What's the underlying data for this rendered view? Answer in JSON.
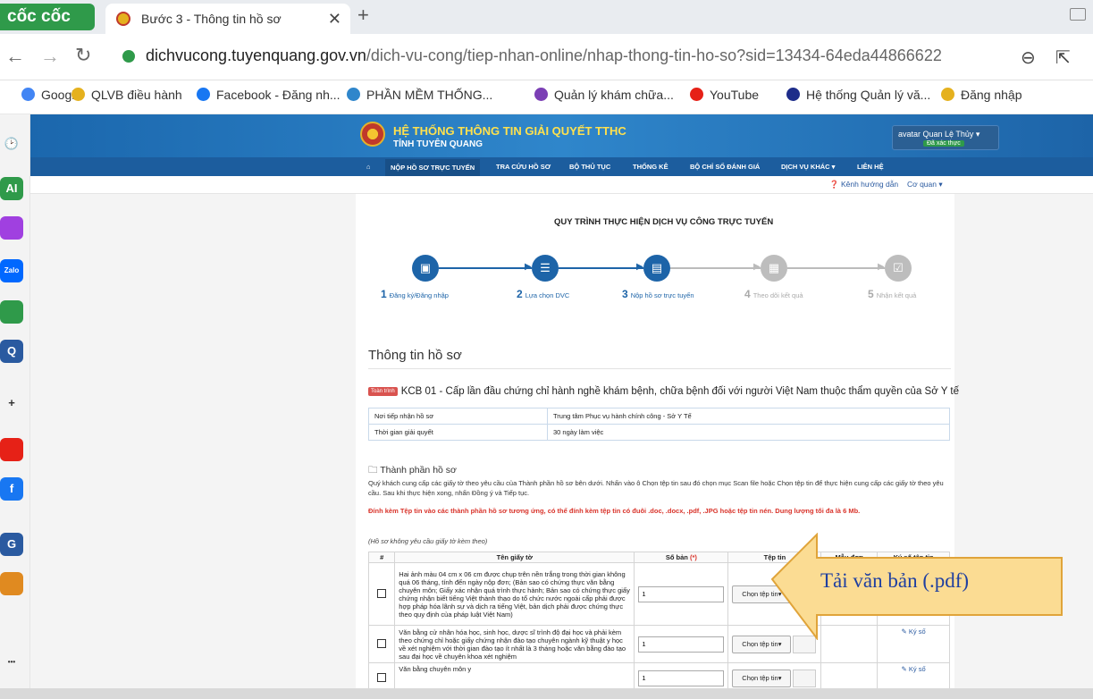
{
  "browser": {
    "brand": "cốc cốc",
    "tab_title": "Bước 3 - Thông tin hồ sơ",
    "tab_close": "✕",
    "new_tab": "+",
    "url_domain": "dichvucong.tuyenquang.gov.vn",
    "url_path": "/dich-vu-cong/tiep-nhan-online/nhap-thong-tin-ho-so?sid=13434-64eda44866622",
    "bookmarks": [
      {
        "label": "Google",
        "color": "#4285f4"
      },
      {
        "label": "QLVB điều hành",
        "color": "#e5b11e"
      },
      {
        "label": "Facebook - Đăng nh...",
        "color": "#1877f2"
      },
      {
        "label": "PHẦN MỀM THỐNG...",
        "color": "#2f86cb"
      },
      {
        "label": "Quản lý khám chữa...",
        "color": "#7b3fb5"
      },
      {
        "label": "YouTube",
        "color": "#e62117"
      },
      {
        "label": "Hệ thống Quản lý vă...",
        "color": "#1e2d8a"
      },
      {
        "label": "Đăng nhập",
        "color": "#e5b11e"
      }
    ]
  },
  "dock": [
    {
      "icon": "clock-icon",
      "label": "🕑",
      "color": "#333333"
    },
    {
      "icon": "ai-icon",
      "label": "AI",
      "color": "#2f9a4a"
    },
    {
      "icon": "messenger-icon",
      "label": "",
      "color": "#a040e0"
    },
    {
      "icon": "zalo-icon",
      "label": "Zalo",
      "color": "#0068ff"
    },
    {
      "icon": "chat-icon",
      "label": "",
      "color": "#2f9a4a"
    },
    {
      "icon": "search-app-icon",
      "label": "Q",
      "color": "#2a5aa0"
    },
    {
      "icon": "plus-icon",
      "label": "+",
      "color": "#333333"
    },
    {
      "icon": "youtube-icon",
      "label": "",
      "color": "#e62117"
    },
    {
      "icon": "facebook-icon",
      "label": "f",
      "color": "#1877f2"
    },
    {
      "icon": "gemini-icon",
      "label": "G",
      "color": "#2a5aa0"
    },
    {
      "icon": "colorful-icon",
      "label": "",
      "color": "#e08a20"
    },
    {
      "icon": "more-icon",
      "label": "•••",
      "color": "#333333"
    }
  ],
  "portal": {
    "title": "HỆ THỐNG THÔNG TIN GIẢI QUYẾT TTHC",
    "subtitle": "TỈNH TUYÊN QUANG",
    "user_label": "avatar Quan Lệ Thủy ▾",
    "user_verified": "Đã xác thực",
    "nav": [
      "NỘP HỒ SƠ TRỰC TUYẾN",
      "TRA CỨU HỒ SƠ",
      "BỘ THỦ TỤC",
      "THỐNG KÊ",
      "BỘ CHỈ SỐ ĐÁNH GIÁ",
      "DỊCH VỤ KHÁC ▾",
      "LIÊN HỆ"
    ],
    "guide_link": "❓ Kênh hướng dẫn",
    "agency_link": "Cơ quan ▾"
  },
  "process": {
    "title": "QUY TRÌNH THỰC HIỆN DỊCH VỤ CÔNG TRỰC TUYẾN",
    "steps": [
      {
        "num": "1",
        "label": "Đăng ký/Đăng nhập",
        "active": true
      },
      {
        "num": "2",
        "label": "Lựa chọn DVC",
        "active": true
      },
      {
        "num": "3",
        "label": "Nộp hồ sơ trực tuyến",
        "active": true
      },
      {
        "num": "4",
        "label": "Theo dõi kết quả",
        "active": false
      },
      {
        "num": "5",
        "label": "Nhận kết quả",
        "active": false
      }
    ]
  },
  "form": {
    "section_title": "Thông tin hồ sơ",
    "badge": "Toàn trình",
    "procedure_name": "KCB 01 - Cấp lần đầu chứng chỉ hành nghề khám bệnh, chữa bệnh đối với người Việt Nam thuộc thẩm quyền của Sở Y tế",
    "info": [
      {
        "label": "Nơi tiếp nhận hồ sơ",
        "value": "Trung tâm Phục vụ hành chính công - Sở Y Tế"
      },
      {
        "label": "Thời gian giải quyết",
        "value": "30 ngày làm việc"
      }
    ],
    "components_title": "🗀 Thành phần hồ sơ",
    "instructions": "Quý khách cung cấp các giấy tờ theo yêu cầu của Thành phần hồ sơ bên dưới. Nhấn vào ô Chọn tệp tin sau đó chọn mục Scan file hoặc Chọn tệp tin để thực hiện cung cấp các giấy tờ theo yêu cầu. Sau khi thực hiện xong, nhấn Đồng ý và Tiếp tục.",
    "warning": "Đính kèm Tệp tin vào các thành phần hồ sơ tương ứng, có thể đính kèm tệp tin có đuôi .doc, .docx, .pdf, .JPG hoặc tệp tin nén. Dung lượng tối đa là 6 Mb.",
    "note": "(Hồ sơ không yêu cầu giấy tờ kèm theo)",
    "columns": {
      "index": "#",
      "name": "Tên giấy tờ",
      "copies": "Số bản",
      "copies_req": "(*)",
      "file": "Tệp tin",
      "template": "Mẫu đơn",
      "signed": "Ký số tệp tin"
    },
    "rows": [
      {
        "name": "Hai ảnh màu 04 cm x 06 cm được chụp trên nền trắng trong thời gian không quá 06 tháng, tính đến ngày nộp đơn; (Bản sao có chứng thực văn bằng chuyên môn; Giấy xác nhận quá trình thực hành; Bản sao có chứng thực giấy chứng nhận biết tiếng Việt thành thạo do tổ chức nước ngoài cấp phải được hợp pháp hóa lãnh sự và dịch ra tiếng Việt, bản dịch phải được chứng thực theo quy định của pháp luật Việt Nam)",
        "copies": "1",
        "button": "Chọn tệp tin▾",
        "sign": "✎ Ký số"
      },
      {
        "name": "Văn bằng cử nhân hóa học, sinh học, dược sĩ trình độ đại học và phải kèm theo chứng chỉ hoặc giấy chứng nhận đào tạo chuyên ngành kỹ thuật y học về xét nghiệm với thời gian đào tạo ít nhất là 3 tháng hoặc văn bằng đào tạo sau đại học về chuyên khoa xét nghiệm",
        "copies": "1",
        "button": "Chọn tệp tin▾",
        "sign": "✎ Ký số"
      },
      {
        "name": "Văn bằng chuyên môn y",
        "copies": "1",
        "button": "Chọn tệp tin▾",
        "sign": "✎ Ký số"
      }
    ]
  },
  "callout": {
    "text": "Tải văn bản (.pdf)",
    "fill": "#fbdc93",
    "stroke": "#e0a43a"
  }
}
